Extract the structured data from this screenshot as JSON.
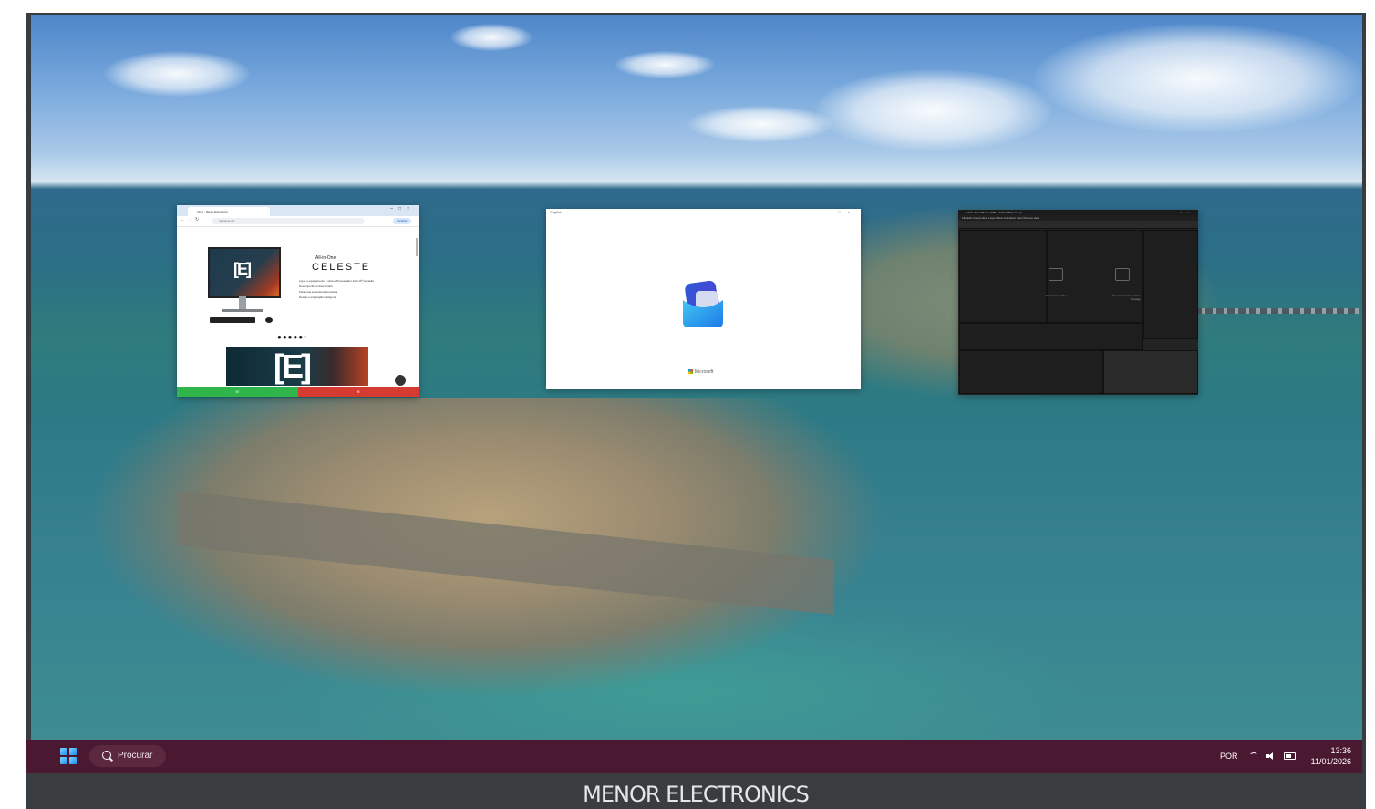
{
  "bezel": {
    "brand": "MENOR ELECTRONICS"
  },
  "windows": {
    "chrome": {
      "tab_title": "Início - Menor Electronics",
      "address": "menor.co.mz",
      "share_label": "Partilhar",
      "subheading": "All-in-One",
      "brand": "CELESTE",
      "features": [
        "Ligue o equipamento e sinta o Processador Intel 14ª Geração",
        "Desempenho extraordinário",
        "Para uma experiência completa",
        "Design e integração inteligente"
      ],
      "logo": "[E]",
      "carousel_dots": "●●●●●•"
    },
    "copilot": {
      "title": "Copilot",
      "brand": "Microsoft"
    },
    "after_effects": {
      "title": "Adobe After Effects 2025 - Untitled Project.aep",
      "menu": "File  Edit  Composition  Layer  Effect  Animation  View  Window  Help",
      "new_composition": "New Composition",
      "new_composition_from_footage": "New Composition From Footage"
    }
  },
  "taskbar": {
    "search_label": "Procurar",
    "language": "POR",
    "time": "13:36",
    "date": "11/01/2026"
  },
  "colors": {
    "taskbar": "#4a1931",
    "bezel": "#3a3d40"
  },
  "icons": [
    "windows-start-icon",
    "search-icon",
    "wifi-icon",
    "volume-icon",
    "battery-icon",
    "copilot-icon",
    "microsoft-logo-icon"
  ]
}
